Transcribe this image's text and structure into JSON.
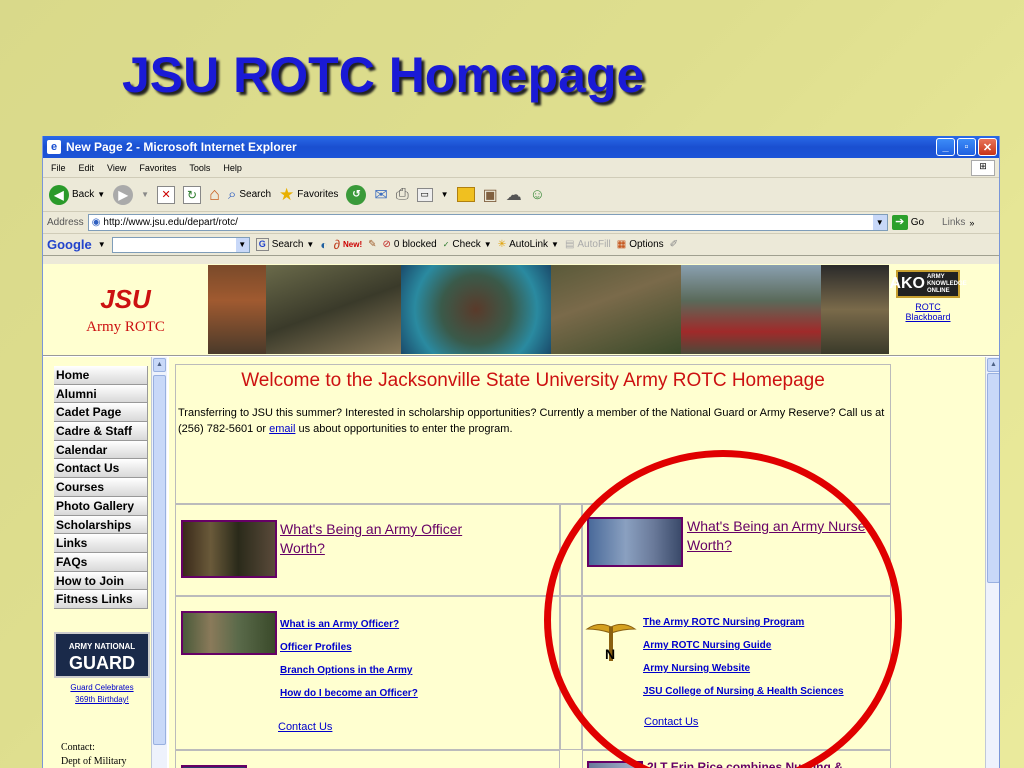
{
  "slide": {
    "title": "JSU ROTC Homepage"
  },
  "window": {
    "title": "New Page 2 - Microsoft Internet Explorer",
    "menu": [
      "File",
      "Edit",
      "View",
      "Favorites",
      "Tools",
      "Help"
    ],
    "toolbar": {
      "back": "Back",
      "search": "Search",
      "favorites": "Favorites"
    },
    "address_label": "Address",
    "url": "http://www.jsu.edu/depart/rotc/",
    "go": "Go",
    "links": "Links",
    "google": {
      "logo": "Google",
      "search": "Search",
      "new_badge": "New!",
      "blocked": "0 blocked",
      "check": "Check",
      "autolink": "AutoLink",
      "autofill": "AutoFill",
      "options": "Options"
    }
  },
  "banner": {
    "logo_text": "JSU",
    "subtitle": "Army ROTC",
    "ako": "AKO",
    "ako_small": "ARMY KNOWLEDGE ONLINE",
    "ako_link": "ROTC Blackboard"
  },
  "nav": {
    "items": [
      "Home",
      "Alumni",
      "Cadet Page",
      "Cadre & Staff",
      "Calendar",
      "Contact Us",
      "Courses",
      "Photo Gallery",
      "Scholarships",
      "Links",
      "FAQs",
      "How to Join",
      "Fitness Links"
    ],
    "guard_logo": "GUARD",
    "guard_logo_small": "ARMY NATIONAL",
    "guard_link": "Guard Celebrates 369th Birthday!",
    "contact": [
      "Contact:",
      "Dept of Military"
    ]
  },
  "main": {
    "welcome_title": "Welcome to the Jacksonville State University Army ROTC Homepage",
    "welcome_text_before": "Transferring to JSU this summer?  Interested in scholarship opportunities?  Currently a member of the National Guard or Army Reserve?  Call us at (256) 782-5601 or ",
    "email_link": "email",
    "welcome_text_after": " us about opportunities to enter the program.",
    "officer_worth": "What's Being an Army Officer Worth?",
    "nurse_worth": "What's Being an Army Nurse Worth?",
    "officer_links": [
      "What is an Army Officer?",
      "Officer Profiles",
      "Branch Options in the Army",
      "How do I become an Officer?"
    ],
    "officer_contact": "Contact Us",
    "nursing_links": [
      "The Army ROTC Nursing Program",
      "Army ROTC Nursing Guide",
      "Army Nursing Website",
      "JSU College of Nursing & Health Sciences"
    ],
    "nursing_contact": "Contact Us",
    "bottom_right": "2LT Erin Rice combines Nursing &"
  }
}
